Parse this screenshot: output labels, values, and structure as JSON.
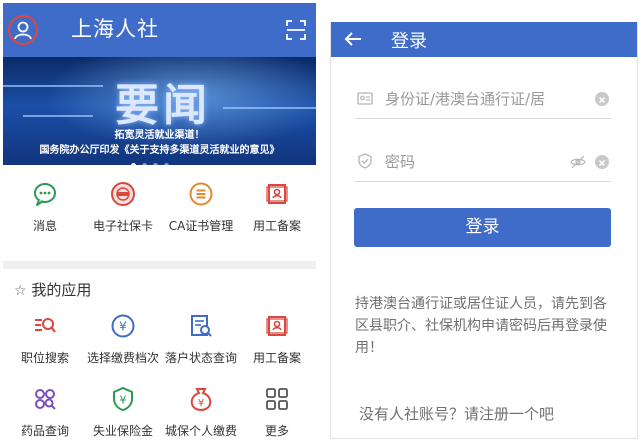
{
  "left": {
    "header": {
      "title": "上海人社"
    },
    "banner": {
      "headline": "要闻",
      "caption_line1": "拓宽灵活就业渠道！",
      "caption_line2": "国务院办公厅印发《关于支持多渠道灵活就业的意见》"
    },
    "quick_items": [
      {
        "label": "消息",
        "icon": "message-icon"
      },
      {
        "label": "电子社保卡",
        "icon": "social-security-card-icon"
      },
      {
        "label": "CA证书管理",
        "icon": "ca-certificate-icon"
      },
      {
        "label": "用工备案",
        "icon": "employment-record-icon"
      }
    ],
    "apps": {
      "title": "我的应用",
      "items": [
        {
          "label": "职位搜索",
          "icon": "job-search-icon"
        },
        {
          "label": "选择缴费档次",
          "icon": "payment-level-icon"
        },
        {
          "label": "落户状态查询",
          "icon": "household-status-icon"
        },
        {
          "label": "用工备案",
          "icon": "employment-record-icon"
        },
        {
          "label": "药品查询",
          "icon": "medicine-search-icon"
        },
        {
          "label": "失业保险金",
          "icon": "unemployment-insurance-icon"
        },
        {
          "label": "城保个人缴费",
          "icon": "personal-payment-icon"
        },
        {
          "label": "更多",
          "icon": "more-grid-icon"
        }
      ]
    }
  },
  "right": {
    "header": {
      "title": "登录"
    },
    "id_field": {
      "placeholder": "身份证/港澳台通行证/居"
    },
    "password_field": {
      "placeholder": "密码"
    },
    "login_button": "登录",
    "hint": "持港澳台通行证或居住证人员，请先到各区县职介、社保机构申请密码后再登录使用！",
    "register": "没有人社账号？请注册一个吧"
  },
  "colors": {
    "brand_blue": "#3f6cc9",
    "icon_red": "#d9473d",
    "icon_blue": "#3f6cc9",
    "icon_green": "#2e9a4f",
    "icon_orange": "#e08a2c",
    "icon_purple": "#7a4fbf"
  }
}
